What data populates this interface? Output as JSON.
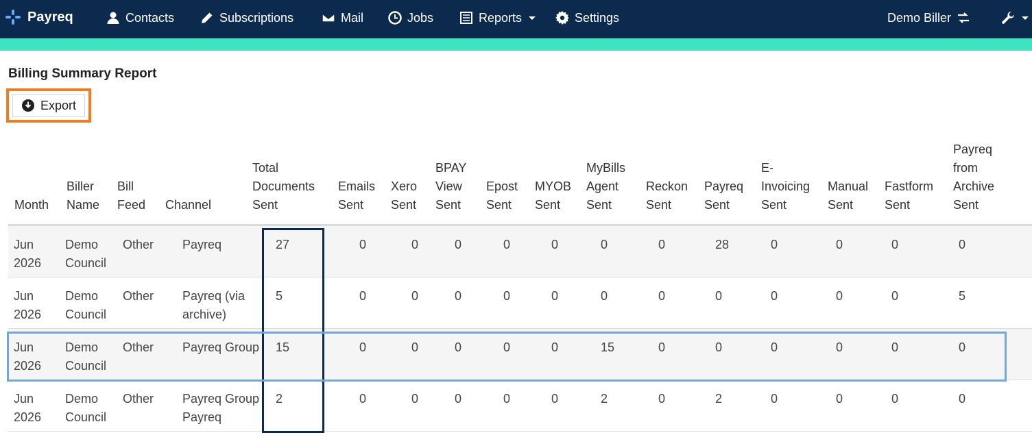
{
  "nav": {
    "brand": "Payreq",
    "items": [
      {
        "label": "Contacts",
        "icon": "user-icon"
      },
      {
        "label": "Subscriptions",
        "icon": "pencil-icon"
      },
      {
        "label": "Mail",
        "icon": "envelope-icon"
      },
      {
        "label": "Jobs",
        "icon": "clock-icon"
      },
      {
        "label": "Reports",
        "icon": "report-icon"
      },
      {
        "label": "Settings",
        "icon": "gear-icon"
      }
    ],
    "user": "Demo Biller"
  },
  "page": {
    "title": "Billing Summary Report",
    "export_label": "Export"
  },
  "table": {
    "headers": {
      "month": "Month",
      "biller_name": "Biller Name",
      "bill_feed": "Bill Feed",
      "channel": "Channel",
      "total": "Total Documents Sent",
      "emails": "Emails Sent",
      "xero": "Xero Sent",
      "bpay": "BPAY View Sent",
      "epost": "Epost Sent",
      "myob": "MYOB Sent",
      "mybills": "MyBills Agent Sent",
      "reckon": "Reckon Sent",
      "payreq": "Payreq Sent",
      "einvoicing": "E-Invoicing Sent",
      "manual": "Manual Sent",
      "fastform": "Fastform Sent",
      "archive": "Payreq from Archive Sent"
    },
    "rows": [
      {
        "month": "Jun 2026",
        "biller_name": "Demo Council",
        "bill_feed": "Other",
        "channel": "Payreq",
        "total": "27",
        "emails": "0",
        "xero": "0",
        "bpay": "0",
        "epost": "0",
        "myob": "0",
        "mybills": "0",
        "reckon": "0",
        "payreq": "28",
        "einvoicing": "0",
        "manual": "0",
        "fastform": "0",
        "archive": "0"
      },
      {
        "month": "Jun 2026",
        "biller_name": "Demo Council",
        "bill_feed": "Other",
        "channel": "Payreq (via archive)",
        "total": "5",
        "emails": "0",
        "xero": "0",
        "bpay": "0",
        "epost": "0",
        "myob": "0",
        "mybills": "0",
        "reckon": "0",
        "payreq": "0",
        "einvoicing": "0",
        "manual": "0",
        "fastform": "0",
        "archive": "5"
      },
      {
        "month": "Jun 2026",
        "biller_name": "Demo Council",
        "bill_feed": "Other",
        "channel": "Payreq Group",
        "total": "15",
        "emails": "0",
        "xero": "0",
        "bpay": "0",
        "epost": "0",
        "myob": "0",
        "mybills": "15",
        "reckon": "0",
        "payreq": "0",
        "einvoicing": "0",
        "manual": "0",
        "fastform": "0",
        "archive": "0"
      },
      {
        "month": "Jun 2026",
        "biller_name": "Demo Council",
        "bill_feed": "Other",
        "channel": "Payreq Group Payreq",
        "total": "2",
        "emails": "0",
        "xero": "0",
        "bpay": "0",
        "epost": "0",
        "myob": "0",
        "mybills": "2",
        "reckon": "0",
        "payreq": "2",
        "einvoicing": "0",
        "manual": "0",
        "fastform": "0",
        "archive": "0"
      }
    ]
  },
  "colors": {
    "navbar": "#0c2a4d",
    "accent_bar": "#3fe3bf",
    "export_highlight": "#f47b20",
    "row_highlight": "#6fa8e0",
    "column_highlight": "#0c2a4d"
  }
}
